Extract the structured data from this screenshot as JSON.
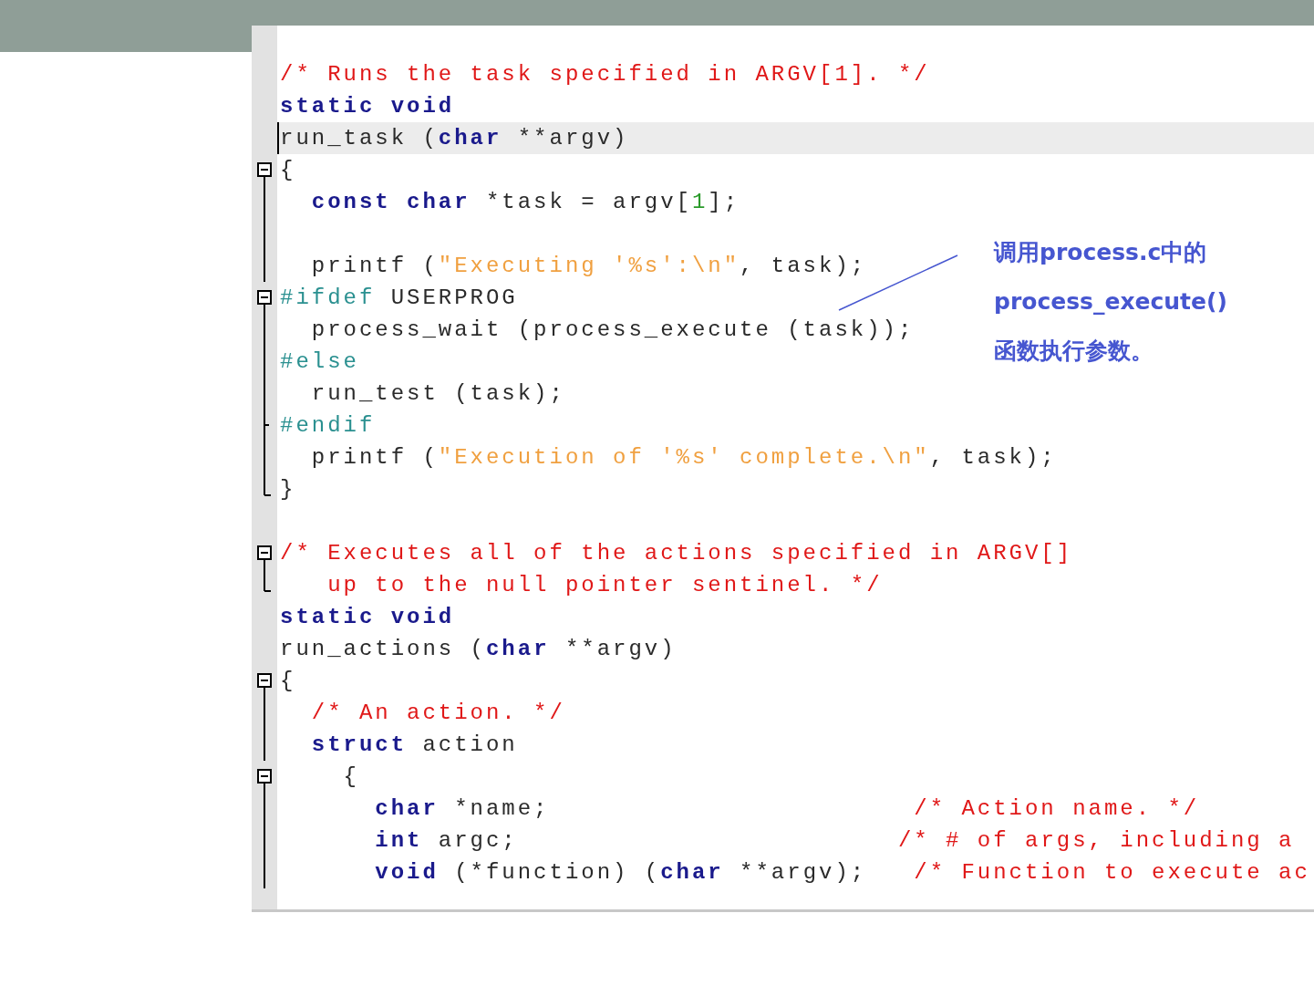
{
  "editor": {
    "lines": [
      {
        "kind": "none",
        "current": false,
        "tokens": [
          {
            "kind": "comment",
            "text": "/* Runs the task specified in ARGV[1]. */"
          }
        ]
      },
      {
        "kind": "none",
        "current": false,
        "tokens": [
          {
            "kind": "keyword",
            "text": "static void"
          }
        ]
      },
      {
        "kind": "none",
        "current": true,
        "tokens": [
          {
            "kind": "plain",
            "text": "run_task ("
          },
          {
            "kind": "keyword",
            "text": "char"
          },
          {
            "kind": "plain",
            "text": " **argv)"
          }
        ]
      },
      {
        "kind": "box",
        "current": false,
        "tokens": [
          {
            "kind": "plain",
            "text": "{"
          }
        ]
      },
      {
        "kind": "line",
        "current": false,
        "tokens": [
          {
            "kind": "keyword",
            "text": "  const char"
          },
          {
            "kind": "plain",
            "text": " *task = argv["
          },
          {
            "kind": "number",
            "text": "1"
          },
          {
            "kind": "plain",
            "text": "];"
          }
        ]
      },
      {
        "kind": "line",
        "current": false
      },
      {
        "kind": "line",
        "current": false,
        "tokens": [
          {
            "kind": "plain",
            "text": "  printf ("
          },
          {
            "kind": "string",
            "text": "\"Executing '%s':\\n\""
          },
          {
            "kind": "plain",
            "text": ", task);"
          }
        ]
      },
      {
        "kind": "box",
        "current": false,
        "tokens": [
          {
            "kind": "preprocessor",
            "text": "#ifdef"
          },
          {
            "kind": "plain",
            "text": " USERPROG"
          }
        ]
      },
      {
        "kind": "line",
        "current": false,
        "tokens": [
          {
            "kind": "plain",
            "text": "  process_wait (process_execute (task));"
          }
        ]
      },
      {
        "kind": "line",
        "current": false,
        "tokens": [
          {
            "kind": "preprocessor",
            "text": "#else"
          }
        ]
      },
      {
        "kind": "line",
        "current": false,
        "tokens": [
          {
            "kind": "plain",
            "text": "  run_test (task);"
          }
        ]
      },
      {
        "kind": "tee",
        "current": false,
        "tokens": [
          {
            "kind": "preprocessor",
            "text": "#endif"
          }
        ]
      },
      {
        "kind": "line",
        "current": false,
        "tokens": [
          {
            "kind": "plain",
            "text": "  printf ("
          },
          {
            "kind": "string",
            "text": "\"Execution of '%s' complete.\\n\""
          },
          {
            "kind": "plain",
            "text": ", task);"
          }
        ]
      },
      {
        "kind": "end",
        "current": false,
        "tokens": [
          {
            "kind": "plain",
            "text": "}"
          }
        ]
      },
      {
        "kind": "none",
        "current": false
      },
      {
        "kind": "box",
        "current": false,
        "tokens": [
          {
            "kind": "comment",
            "text": "/* Executes all of the actions specified in ARGV[]"
          }
        ]
      },
      {
        "kind": "end",
        "current": false,
        "tokens": [
          {
            "kind": "comment",
            "text": "   up to the null pointer sentinel. */"
          }
        ]
      },
      {
        "kind": "none",
        "current": false,
        "tokens": [
          {
            "kind": "keyword",
            "text": "static void"
          }
        ]
      },
      {
        "kind": "none",
        "current": false,
        "tokens": [
          {
            "kind": "plain",
            "text": "run_actions ("
          },
          {
            "kind": "keyword",
            "text": "char"
          },
          {
            "kind": "plain",
            "text": " **argv)"
          }
        ]
      },
      {
        "kind": "box",
        "current": false,
        "tokens": [
          {
            "kind": "plain",
            "text": "{"
          }
        ]
      },
      {
        "kind": "line",
        "current": false,
        "tokens": [
          {
            "kind": "comment",
            "text": "  /* An action. */"
          }
        ]
      },
      {
        "kind": "line",
        "current": false,
        "tokens": [
          {
            "kind": "keyword",
            "text": "  struct"
          },
          {
            "kind": "plain",
            "text": " action"
          }
        ]
      },
      {
        "kind": "box",
        "current": false,
        "tokens": [
          {
            "kind": "plain",
            "text": "    {"
          }
        ]
      },
      {
        "kind": "line",
        "current": false,
        "tokens": [
          {
            "kind": "keyword",
            "text": "      char"
          },
          {
            "kind": "plain",
            "text": " *name;                       "
          },
          {
            "kind": "comment",
            "text": "/* Action name. */"
          }
        ]
      },
      {
        "kind": "line",
        "current": false,
        "tokens": [
          {
            "kind": "keyword",
            "text": "      int"
          },
          {
            "kind": "plain",
            "text": " argc;                        "
          },
          {
            "kind": "comment",
            "text": "/* # of args, including a"
          }
        ]
      },
      {
        "kind": "line",
        "current": false,
        "tokens": [
          {
            "kind": "keyword",
            "text": "      void"
          },
          {
            "kind": "plain",
            "text": " (*function) ("
          },
          {
            "kind": "keyword",
            "text": "char"
          },
          {
            "kind": "plain",
            "text": " **argv);   "
          },
          {
            "kind": "comment",
            "text": "/* Function to execute ac"
          }
        ]
      }
    ]
  },
  "annotation": {
    "lines": [
      "调用process.c中的",
      "process_execute()",
      "函数执行参数。"
    ]
  }
}
